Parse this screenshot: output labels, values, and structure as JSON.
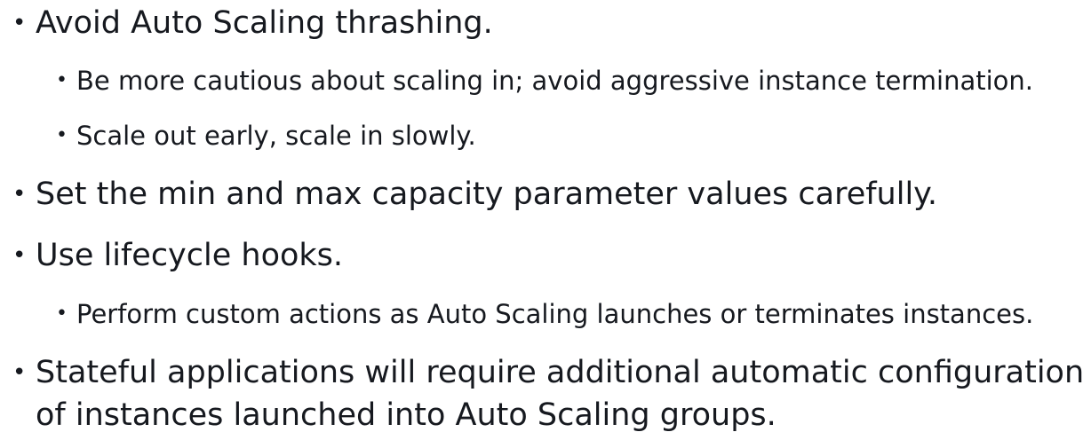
{
  "bullets": {
    "b1": "Avoid Auto Scaling thrashing.",
    "b1_sub1": "Be more cautious about scaling in; avoid aggressive instance termination.",
    "b1_sub2": "Scale out early, scale in slowly.",
    "b2": "Set the min and max capacity parameter values carefully.",
    "b3": "Use lifecycle hooks.",
    "b3_sub1": "Perform custom actions as Auto Scaling launches or terminates instances.",
    "b4_line1": "Stateful applications will require additional automatic configuration",
    "b4_line2": "of instances launched into Auto Scaling groups."
  },
  "bullet_glyph": "•",
  "colors": {
    "text": "#16191f",
    "background": "#ffffff"
  }
}
